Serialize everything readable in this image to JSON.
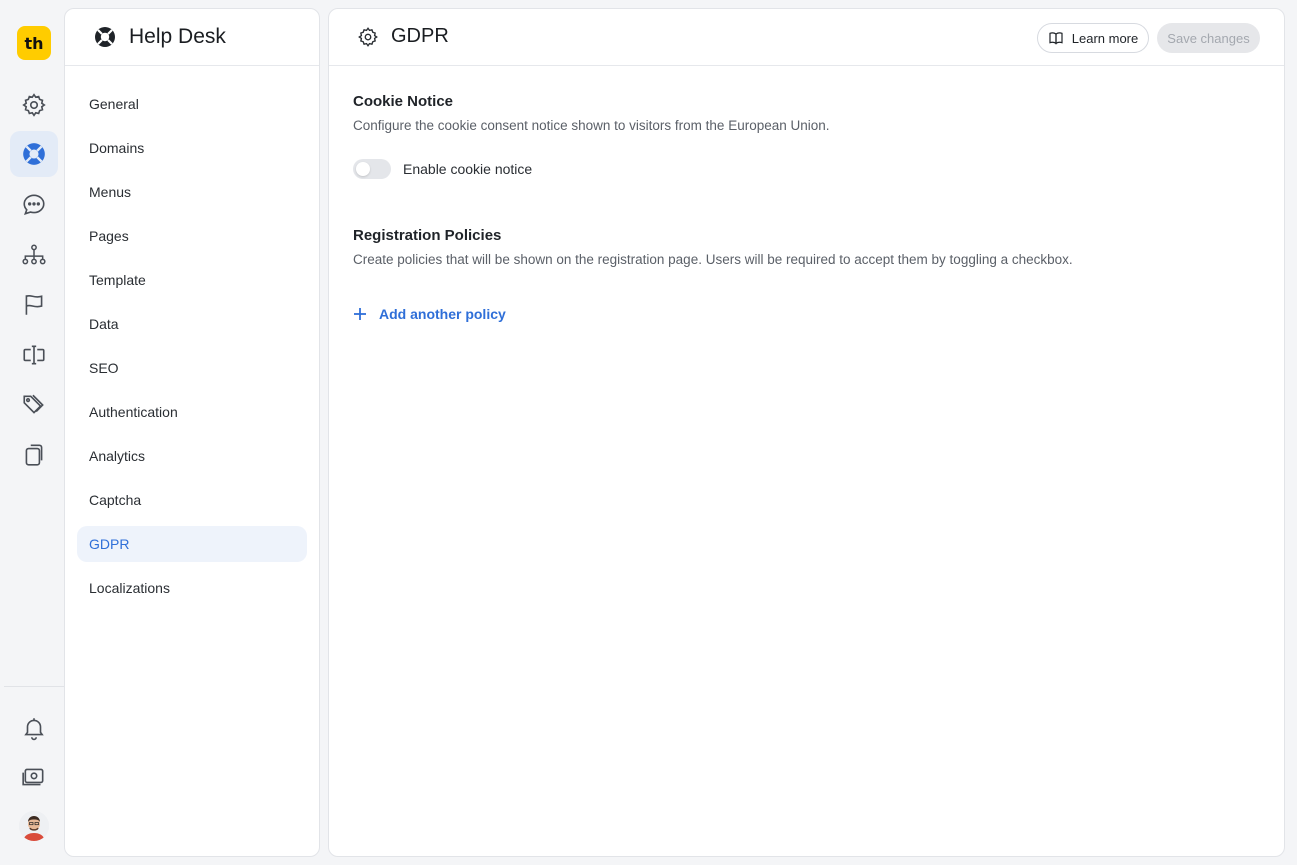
{
  "app": {
    "logo_text": "th",
    "brand_color": "#ffcc00",
    "accent_color": "#2f6fd8"
  },
  "rail": {
    "items": [
      {
        "icon": "gear-icon"
      },
      {
        "icon": "lifebuoy-icon",
        "active": true
      },
      {
        "icon": "chat-bubble-icon"
      },
      {
        "icon": "sitemap-icon"
      },
      {
        "icon": "flag-icon"
      },
      {
        "icon": "text-cursor-icon"
      },
      {
        "icon": "tags-icon"
      },
      {
        "icon": "copy-icon"
      }
    ],
    "bottom": [
      {
        "icon": "bell-icon"
      },
      {
        "icon": "billing-icon"
      },
      {
        "icon": "avatar"
      }
    ]
  },
  "nav": {
    "title": "Help Desk",
    "items": [
      {
        "label": "General"
      },
      {
        "label": "Domains"
      },
      {
        "label": "Menus"
      },
      {
        "label": "Pages"
      },
      {
        "label": "Template"
      },
      {
        "label": "Data"
      },
      {
        "label": "SEO"
      },
      {
        "label": "Authentication"
      },
      {
        "label": "Analytics"
      },
      {
        "label": "Captcha"
      },
      {
        "label": "GDPR",
        "active": true
      },
      {
        "label": "Localizations"
      }
    ]
  },
  "header": {
    "title": "GDPR",
    "learn_more_label": "Learn more",
    "save_label": "Save changes"
  },
  "cookie_notice": {
    "title": "Cookie Notice",
    "description": "Configure the cookie consent notice shown to visitors from the European Union.",
    "toggle_label": "Enable cookie notice",
    "enabled": false
  },
  "registration_policies": {
    "title": "Registration Policies",
    "description": "Create policies that will be shown on the registration page. Users will be required to accept them by toggling a checkbox.",
    "add_label": "Add another policy"
  }
}
